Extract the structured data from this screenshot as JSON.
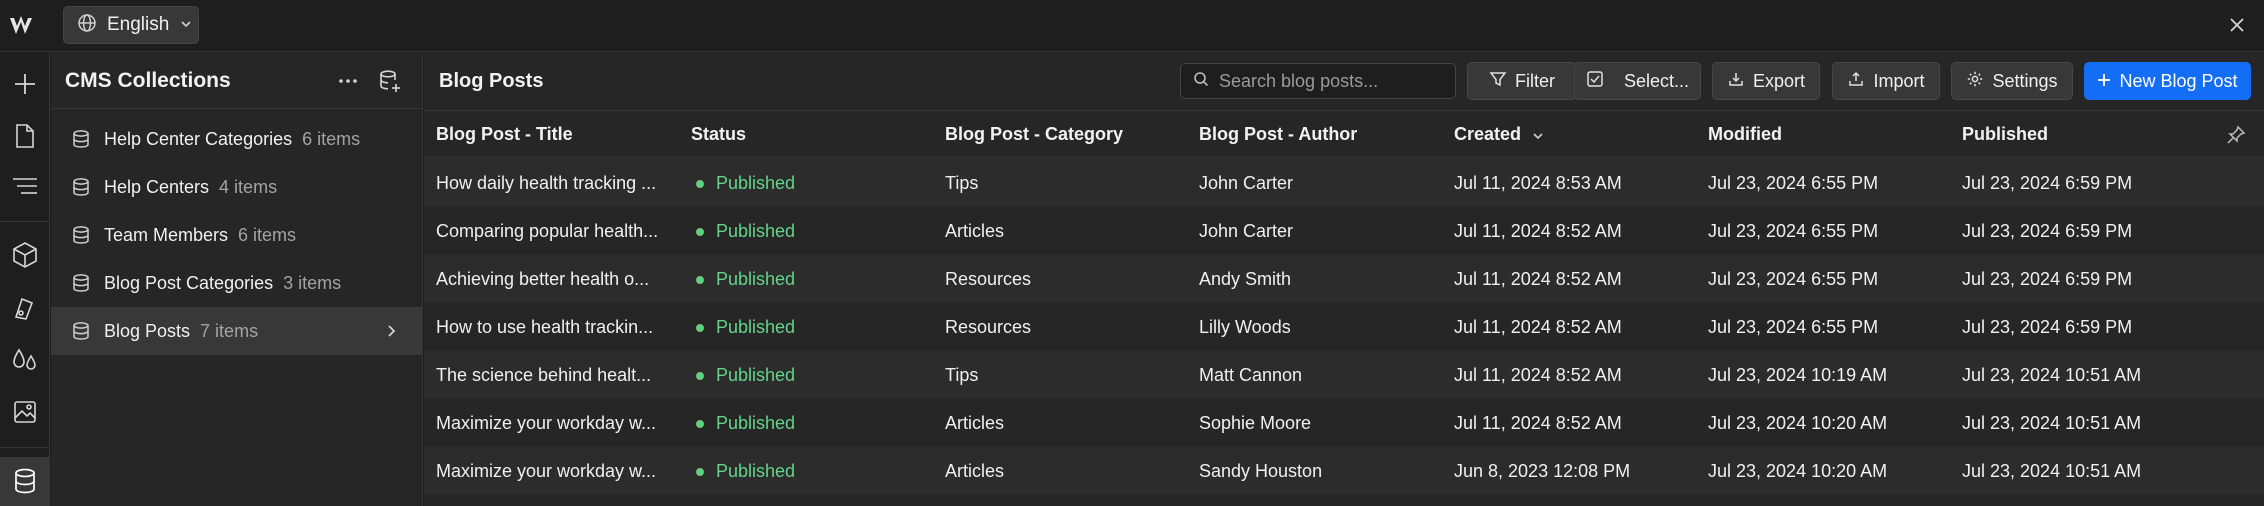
{
  "app": {
    "language_label": "English",
    "accent_color": "#146ef5",
    "published_color": "#63d488"
  },
  "rail": {
    "icons": [
      "add-icon",
      "page-icon",
      "navigator-icon",
      "components-icon",
      "style-icon",
      "variables-icon",
      "assets-icon",
      "cms-icon"
    ]
  },
  "collections": {
    "title": "CMS Collections",
    "items": [
      {
        "name": "Help Center Categories",
        "count": "6 items"
      },
      {
        "name": "Help Centers",
        "count": "4 items"
      },
      {
        "name": "Team Members",
        "count": "6 items"
      },
      {
        "name": "Blog Post Categories",
        "count": "3 items"
      },
      {
        "name": "Blog Posts",
        "count": "7 items"
      }
    ]
  },
  "main": {
    "title": "Blog Posts",
    "search_placeholder": "Search blog posts...",
    "filter_label": "Filter",
    "select_label": "Select...",
    "export_label": "Export",
    "import_label": "Import",
    "settings_label": "Settings",
    "new_label": "New Blog Post"
  },
  "table": {
    "columns": [
      "Blog Post - Title",
      "Status",
      "Blog Post - Category",
      "Blog Post - Author",
      "Created",
      "Modified",
      "Published"
    ],
    "rows": [
      {
        "title": "How daily health tracking ...",
        "status": "Published",
        "category": "Tips",
        "author": "John Carter",
        "created": "Jul 11, 2024 8:53 AM",
        "modified": "Jul 23, 2024 6:55 PM",
        "published": "Jul 23, 2024 6:59 PM"
      },
      {
        "title": "Comparing popular health...",
        "status": "Published",
        "category": "Articles",
        "author": "John Carter",
        "created": "Jul 11, 2024 8:52 AM",
        "modified": "Jul 23, 2024 6:55 PM",
        "published": "Jul 23, 2024 6:59 PM"
      },
      {
        "title": "Achieving better health o...",
        "status": "Published",
        "category": "Resources",
        "author": "Andy Smith",
        "created": "Jul 11, 2024 8:52 AM",
        "modified": "Jul 23, 2024 6:55 PM",
        "published": "Jul 23, 2024 6:59 PM"
      },
      {
        "title": "How to use health trackin...",
        "status": "Published",
        "category": "Resources",
        "author": "Lilly Woods",
        "created": "Jul 11, 2024 8:52 AM",
        "modified": "Jul 23, 2024 6:55 PM",
        "published": "Jul 23, 2024 6:59 PM"
      },
      {
        "title": "The science behind healt...",
        "status": "Published",
        "category": "Tips",
        "author": "Matt Cannon",
        "created": "Jul 11, 2024 8:52 AM",
        "modified": "Jul 23, 2024 10:19 AM",
        "published": "Jul 23, 2024 10:51 AM"
      },
      {
        "title": "Maximize your workday w...",
        "status": "Published",
        "category": "Articles",
        "author": "Sophie Moore",
        "created": "Jul 11, 2024 8:52 AM",
        "modified": "Jul 23, 2024 10:20 AM",
        "published": "Jul 23, 2024 10:51 AM"
      },
      {
        "title": "Maximize your workday w...",
        "status": "Published",
        "category": "Articles",
        "author": "Sandy Houston",
        "created": "Jun 8, 2023 12:08 PM",
        "modified": "Jul 23, 2024 10:20 AM",
        "published": "Jul 23, 2024 10:51 AM"
      }
    ]
  }
}
